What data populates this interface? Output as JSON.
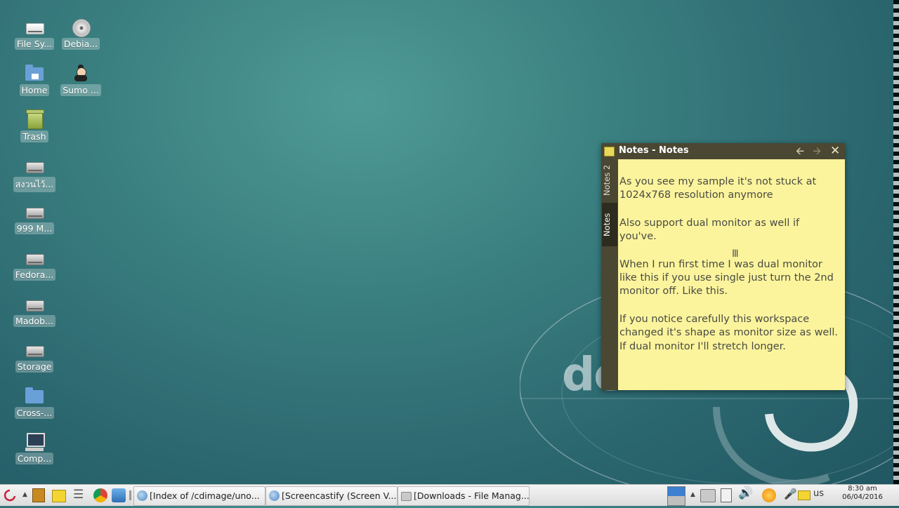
{
  "desktop_icons": [
    {
      "label": "File Sy...",
      "icon": "drive-icon"
    },
    {
      "label": "Debia...",
      "icon": "cd-icon"
    },
    {
      "label": "Home",
      "icon": "home-folder-icon"
    },
    {
      "label": "Sumo ...",
      "icon": "sumo-icon"
    },
    {
      "label": "Trash",
      "icon": "trash-icon"
    },
    {
      "label": "สงวนไว้...",
      "icon": "drive-icon"
    },
    {
      "label": "999 M...",
      "icon": "drive-icon"
    },
    {
      "label": "Fedora...",
      "icon": "drive-icon"
    },
    {
      "label": "Madob...",
      "icon": "drive-icon"
    },
    {
      "label": "Storage",
      "icon": "drive-icon"
    },
    {
      "label": "Cross-...",
      "icon": "folder-icon"
    },
    {
      "label": "Comp...",
      "icon": "computer-icon"
    }
  ],
  "wallpaper": {
    "word": "de"
  },
  "notes_window": {
    "title": "Notes - Notes",
    "tabs": [
      "Notes 2",
      "Notes"
    ],
    "paragraphs": [
      "As you see my sample it's not stuck at 1024x768 resolution anymore",
      "Also support dual monitor as well if you've.",
      "When I run first time I was dual monitor like this if you use single just turn the 2nd monitor off. Like this.",
      "If you notice carefully this workspace changed it's shape as monitor size as well. If dual monitor I'll stretch longer."
    ]
  },
  "taskbar": {
    "tasks": [
      {
        "label": "[Index of /cdimage/uno...",
        "icon": "browser-icon"
      },
      {
        "label": "[Screencastify (Screen V...",
        "icon": "browser-icon"
      },
      {
        "label": "[Downloads - File Manag...",
        "icon": "folder-icon"
      }
    ],
    "keyboard_layout": "us",
    "clock_time": "8:30 am",
    "clock_date": "06/04/2016"
  },
  "colors": {
    "note_bg": "#fbf49c",
    "note_chrome": "#4a4732",
    "taskbar_bg": "#e6e6e6"
  }
}
